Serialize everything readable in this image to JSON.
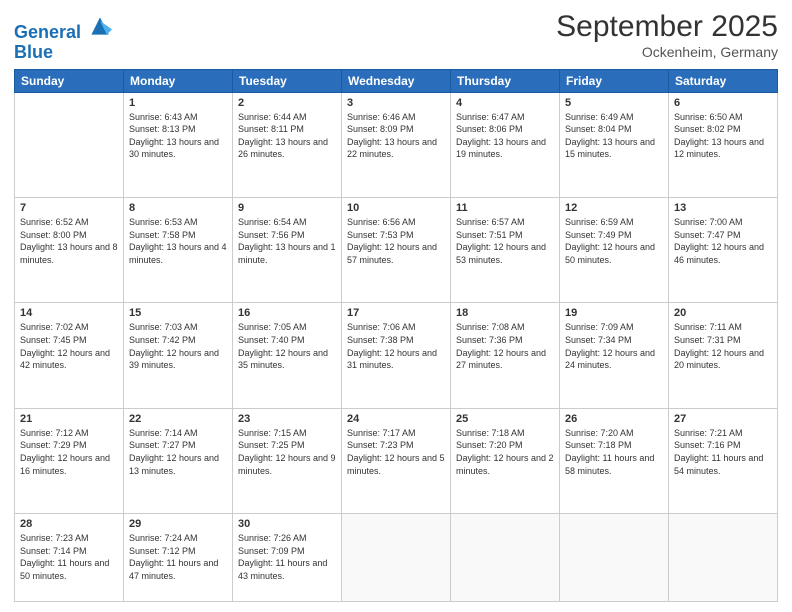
{
  "header": {
    "logo_line1": "General",
    "logo_line2": "Blue",
    "month": "September 2025",
    "location": "Ockenheim, Germany"
  },
  "weekdays": [
    "Sunday",
    "Monday",
    "Tuesday",
    "Wednesday",
    "Thursday",
    "Friday",
    "Saturday"
  ],
  "weeks": [
    [
      {
        "day": "",
        "sunrise": "",
        "sunset": "",
        "daylight": ""
      },
      {
        "day": "1",
        "sunrise": "Sunrise: 6:43 AM",
        "sunset": "Sunset: 8:13 PM",
        "daylight": "Daylight: 13 hours and 30 minutes."
      },
      {
        "day": "2",
        "sunrise": "Sunrise: 6:44 AM",
        "sunset": "Sunset: 8:11 PM",
        "daylight": "Daylight: 13 hours and 26 minutes."
      },
      {
        "day": "3",
        "sunrise": "Sunrise: 6:46 AM",
        "sunset": "Sunset: 8:09 PM",
        "daylight": "Daylight: 13 hours and 22 minutes."
      },
      {
        "day": "4",
        "sunrise": "Sunrise: 6:47 AM",
        "sunset": "Sunset: 8:06 PM",
        "daylight": "Daylight: 13 hours and 19 minutes."
      },
      {
        "day": "5",
        "sunrise": "Sunrise: 6:49 AM",
        "sunset": "Sunset: 8:04 PM",
        "daylight": "Daylight: 13 hours and 15 minutes."
      },
      {
        "day": "6",
        "sunrise": "Sunrise: 6:50 AM",
        "sunset": "Sunset: 8:02 PM",
        "daylight": "Daylight: 13 hours and 12 minutes."
      }
    ],
    [
      {
        "day": "7",
        "sunrise": "Sunrise: 6:52 AM",
        "sunset": "Sunset: 8:00 PM",
        "daylight": "Daylight: 13 hours and 8 minutes."
      },
      {
        "day": "8",
        "sunrise": "Sunrise: 6:53 AM",
        "sunset": "Sunset: 7:58 PM",
        "daylight": "Daylight: 13 hours and 4 minutes."
      },
      {
        "day": "9",
        "sunrise": "Sunrise: 6:54 AM",
        "sunset": "Sunset: 7:56 PM",
        "daylight": "Daylight: 13 hours and 1 minute."
      },
      {
        "day": "10",
        "sunrise": "Sunrise: 6:56 AM",
        "sunset": "Sunset: 7:53 PM",
        "daylight": "Daylight: 12 hours and 57 minutes."
      },
      {
        "day": "11",
        "sunrise": "Sunrise: 6:57 AM",
        "sunset": "Sunset: 7:51 PM",
        "daylight": "Daylight: 12 hours and 53 minutes."
      },
      {
        "day": "12",
        "sunrise": "Sunrise: 6:59 AM",
        "sunset": "Sunset: 7:49 PM",
        "daylight": "Daylight: 12 hours and 50 minutes."
      },
      {
        "day": "13",
        "sunrise": "Sunrise: 7:00 AM",
        "sunset": "Sunset: 7:47 PM",
        "daylight": "Daylight: 12 hours and 46 minutes."
      }
    ],
    [
      {
        "day": "14",
        "sunrise": "Sunrise: 7:02 AM",
        "sunset": "Sunset: 7:45 PM",
        "daylight": "Daylight: 12 hours and 42 minutes."
      },
      {
        "day": "15",
        "sunrise": "Sunrise: 7:03 AM",
        "sunset": "Sunset: 7:42 PM",
        "daylight": "Daylight: 12 hours and 39 minutes."
      },
      {
        "day": "16",
        "sunrise": "Sunrise: 7:05 AM",
        "sunset": "Sunset: 7:40 PM",
        "daylight": "Daylight: 12 hours and 35 minutes."
      },
      {
        "day": "17",
        "sunrise": "Sunrise: 7:06 AM",
        "sunset": "Sunset: 7:38 PM",
        "daylight": "Daylight: 12 hours and 31 minutes."
      },
      {
        "day": "18",
        "sunrise": "Sunrise: 7:08 AM",
        "sunset": "Sunset: 7:36 PM",
        "daylight": "Daylight: 12 hours and 27 minutes."
      },
      {
        "day": "19",
        "sunrise": "Sunrise: 7:09 AM",
        "sunset": "Sunset: 7:34 PM",
        "daylight": "Daylight: 12 hours and 24 minutes."
      },
      {
        "day": "20",
        "sunrise": "Sunrise: 7:11 AM",
        "sunset": "Sunset: 7:31 PM",
        "daylight": "Daylight: 12 hours and 20 minutes."
      }
    ],
    [
      {
        "day": "21",
        "sunrise": "Sunrise: 7:12 AM",
        "sunset": "Sunset: 7:29 PM",
        "daylight": "Daylight: 12 hours and 16 minutes."
      },
      {
        "day": "22",
        "sunrise": "Sunrise: 7:14 AM",
        "sunset": "Sunset: 7:27 PM",
        "daylight": "Daylight: 12 hours and 13 minutes."
      },
      {
        "day": "23",
        "sunrise": "Sunrise: 7:15 AM",
        "sunset": "Sunset: 7:25 PM",
        "daylight": "Daylight: 12 hours and 9 minutes."
      },
      {
        "day": "24",
        "sunrise": "Sunrise: 7:17 AM",
        "sunset": "Sunset: 7:23 PM",
        "daylight": "Daylight: 12 hours and 5 minutes."
      },
      {
        "day": "25",
        "sunrise": "Sunrise: 7:18 AM",
        "sunset": "Sunset: 7:20 PM",
        "daylight": "Daylight: 12 hours and 2 minutes."
      },
      {
        "day": "26",
        "sunrise": "Sunrise: 7:20 AM",
        "sunset": "Sunset: 7:18 PM",
        "daylight": "Daylight: 11 hours and 58 minutes."
      },
      {
        "day": "27",
        "sunrise": "Sunrise: 7:21 AM",
        "sunset": "Sunset: 7:16 PM",
        "daylight": "Daylight: 11 hours and 54 minutes."
      }
    ],
    [
      {
        "day": "28",
        "sunrise": "Sunrise: 7:23 AM",
        "sunset": "Sunset: 7:14 PM",
        "daylight": "Daylight: 11 hours and 50 minutes."
      },
      {
        "day": "29",
        "sunrise": "Sunrise: 7:24 AM",
        "sunset": "Sunset: 7:12 PM",
        "daylight": "Daylight: 11 hours and 47 minutes."
      },
      {
        "day": "30",
        "sunrise": "Sunrise: 7:26 AM",
        "sunset": "Sunset: 7:09 PM",
        "daylight": "Daylight: 11 hours and 43 minutes."
      },
      {
        "day": "",
        "sunrise": "",
        "sunset": "",
        "daylight": ""
      },
      {
        "day": "",
        "sunrise": "",
        "sunset": "",
        "daylight": ""
      },
      {
        "day": "",
        "sunrise": "",
        "sunset": "",
        "daylight": ""
      },
      {
        "day": "",
        "sunrise": "",
        "sunset": "",
        "daylight": ""
      }
    ]
  ]
}
